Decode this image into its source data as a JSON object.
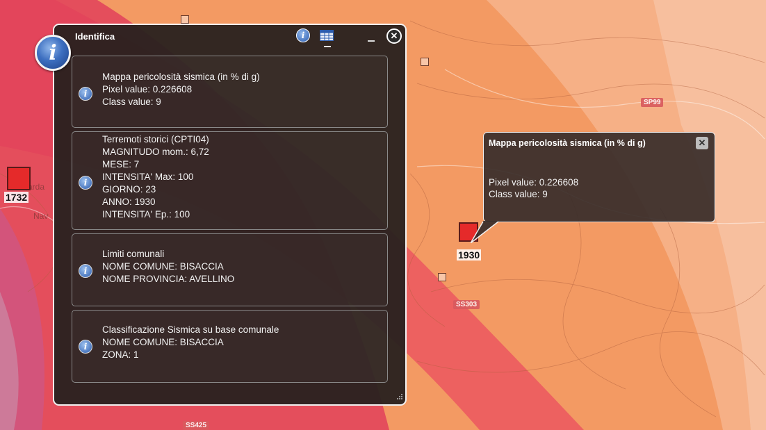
{
  "window": {
    "title": "Identifica",
    "sections": [
      {
        "lines": [
          "Mappa pericolosità sismica (in % di g)",
          "Pixel value: 0.226608",
          "Class value: 9"
        ]
      },
      {
        "lines": [
          "Terremoti storici (CPTI04)",
          "MAGNITUDO mom.: 6,72",
          "MESE: 7",
          "INTENSITA' Max: 100",
          "GIORNO: 23",
          "ANNO: 1930",
          "INTENSITA' Ep.: 100"
        ]
      },
      {
        "lines": [
          "Limiti comunali",
          "NOME COMUNE: BISACCIA",
          "NOME PROVINCIA: AVELLINO"
        ]
      },
      {
        "lines": [
          "Classificazione Sismica su base comunale",
          "NOME COMUNE: BISACCIA",
          "ZONA: 1"
        ]
      }
    ]
  },
  "popup": {
    "title": "Mappa pericolosità sismica (in % di g)",
    "pixel_value": "Pixel value: 0.226608",
    "class_value": "Class value: 9"
  },
  "map": {
    "quakes": [
      "1732",
      "1930"
    ],
    "roads": [
      "SP99",
      "SS303",
      "SS425"
    ]
  },
  "icons": {
    "window": "info-icon",
    "toolbar": [
      "info-icon",
      "table-icon",
      "minimize-icon",
      "close-icon"
    ],
    "popup": "close-icon"
  },
  "colors": {
    "hazard_high": "#e0415a",
    "hazard_mid": "#ee6a5a",
    "hazard_low": "#f39a63",
    "hazard_lowest": "#f6b58e"
  }
}
